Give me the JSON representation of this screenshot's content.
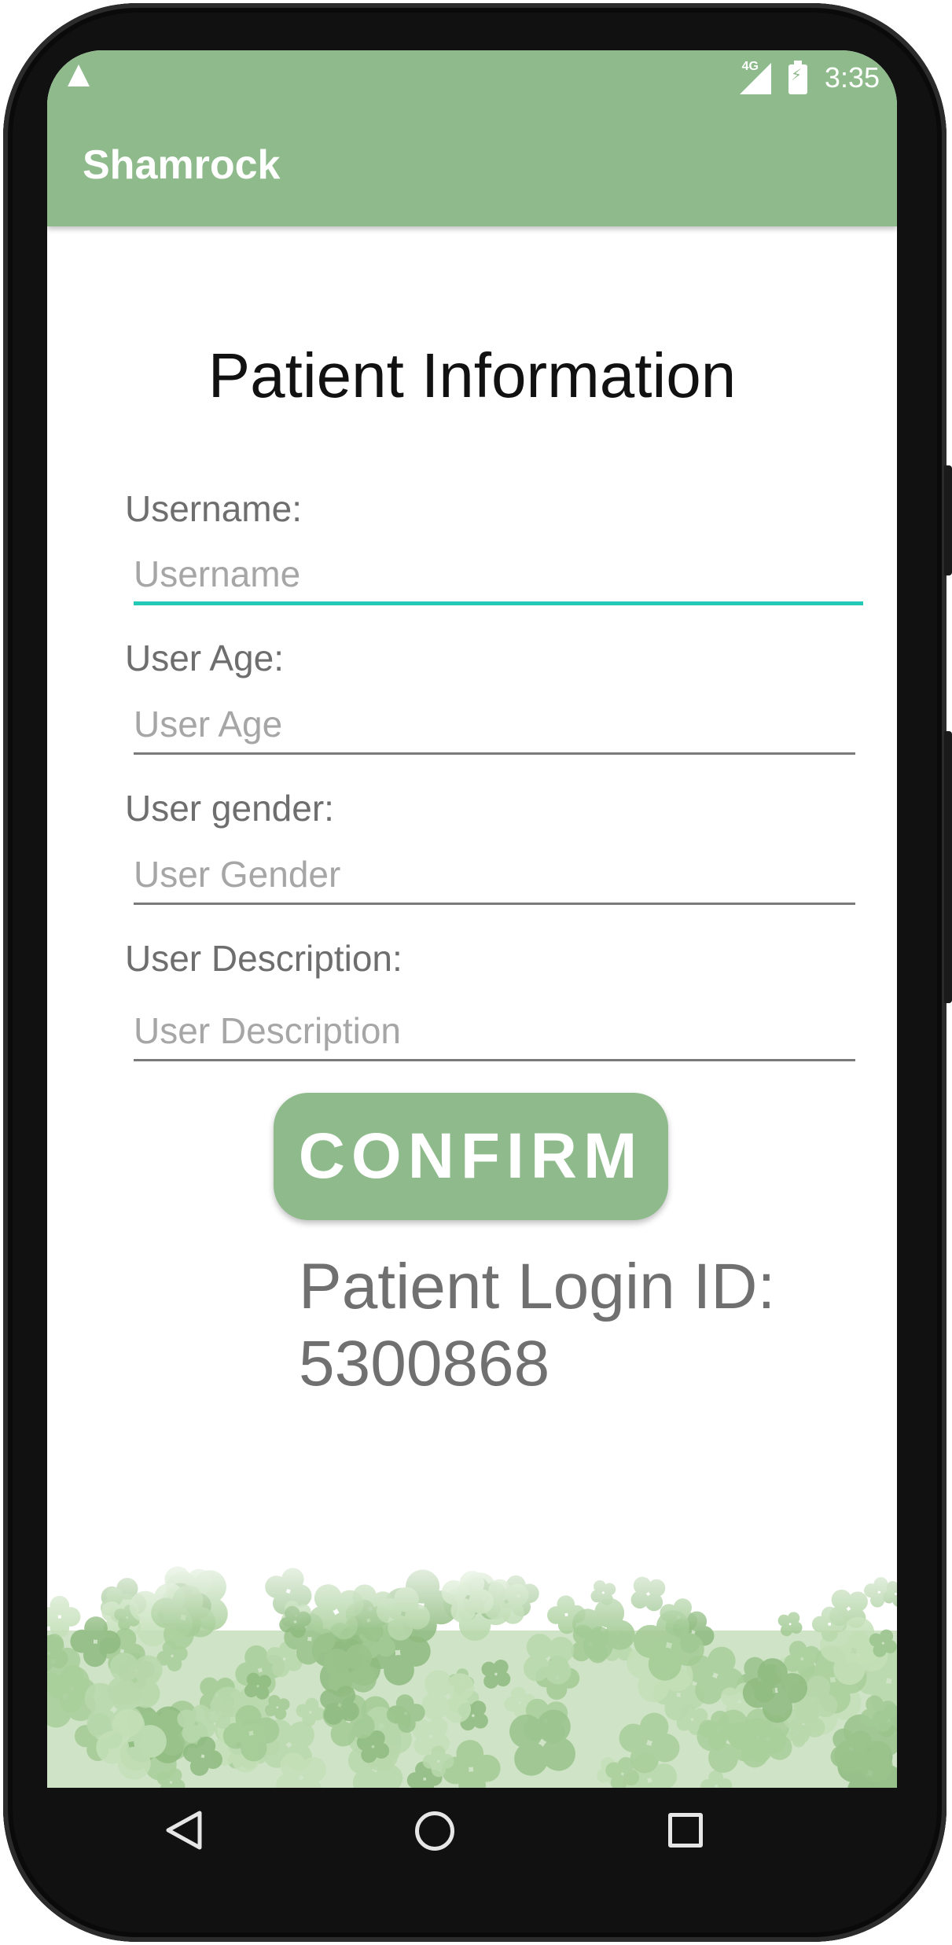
{
  "status_bar": {
    "time": "3:35",
    "network": "4G"
  },
  "app_bar": {
    "title": "Shamrock",
    "color": "#8fbb8c"
  },
  "page": {
    "title": "Patient Information"
  },
  "form": {
    "username": {
      "label": "Username:",
      "placeholder": "Username",
      "value": ""
    },
    "age": {
      "label": "User Age:",
      "placeholder": "User Age",
      "value": ""
    },
    "gender": {
      "label": "User gender:",
      "placeholder": "User Gender",
      "value": ""
    },
    "description": {
      "label": "User Description:",
      "placeholder": "User Description",
      "value": ""
    },
    "focus_color": "#22c9b6"
  },
  "confirm_button": {
    "label": "CONFIRM"
  },
  "login_id": {
    "label": "Patient Login ID:",
    "value": "5300868"
  },
  "nav_bar": {
    "icons": [
      "back-icon",
      "home-icon",
      "recents-icon"
    ]
  },
  "decoration": {
    "background_image": "shamrock-clovers"
  }
}
